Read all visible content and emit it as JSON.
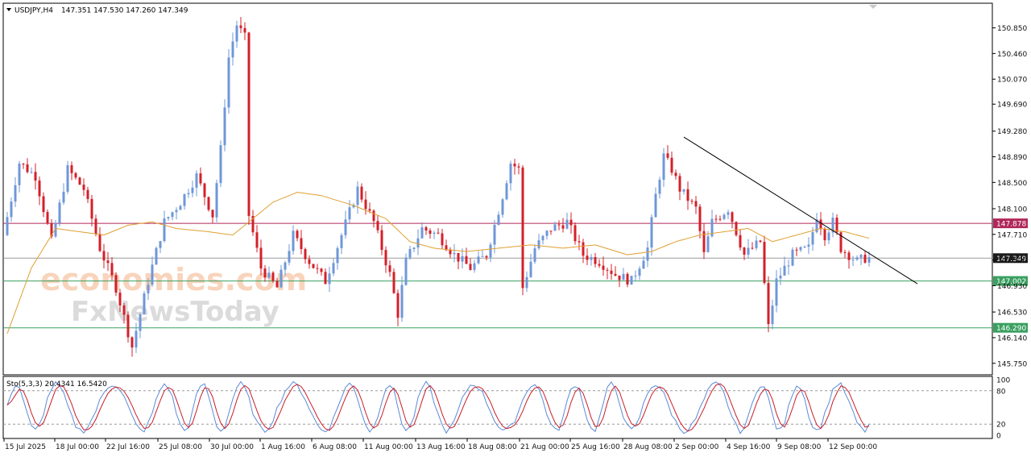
{
  "header": {
    "symbol": "USDJPY,H4",
    "ohlc": "147.351 147.530 147.260 147.349"
  },
  "watermark": {
    "line1": "economies.com",
    "line2": "FxNewsToday"
  },
  "colors": {
    "bull": "#6f97d8",
    "bear": "#d3202a",
    "ma": "#e0a030",
    "resistance": "#b0285a",
    "support": "#3aa060",
    "price": "#1c1c1c",
    "stoch_main": "#5b8ad6",
    "stoch_signal": "#c81e28"
  },
  "chart_data": [
    {
      "type": "candlestick",
      "title": "USDJPY,H4",
      "ylim": [
        145.6,
        151.2
      ],
      "y_ticks": [
        "150.850",
        "150.460",
        "150.070",
        "149.690",
        "149.280",
        "148.890",
        "148.500",
        "148.100",
        "147.710",
        "147.320",
        "146.930",
        "146.530",
        "146.140",
        "145.750"
      ],
      "x_ticks": [
        "15 Jul 2025",
        "18 Jul 00:00",
        "22 Jul 16:00",
        "25 Jul 08:00",
        "30 Jul 00:00",
        "1 Aug 16:00",
        "6 Aug 08:00",
        "11 Aug 00:00",
        "13 Aug 16:00",
        "18 Aug 08:00",
        "21 Aug 00:00",
        "25 Aug 16:00",
        "28 Aug 08:00",
        "2 Sep 00:00",
        "4 Sep 16:00",
        "9 Sep 08:00",
        "12 Sep 00:00"
      ],
      "close_path": [
        [
          0,
          147.7
        ],
        [
          4,
          148.8
        ],
        [
          8,
          148.6
        ],
        [
          12,
          147.6
        ],
        [
          16,
          148.7
        ],
        [
          20,
          148.4
        ],
        [
          24,
          147.5
        ],
        [
          28,
          146.9
        ],
        [
          32,
          146.0
        ],
        [
          36,
          147.0
        ],
        [
          40,
          147.9
        ],
        [
          44,
          148.2
        ],
        [
          48,
          148.6
        ],
        [
          52,
          148.0
        ],
        [
          54,
          149.0
        ],
        [
          56,
          150.4
        ],
        [
          58,
          150.9
        ],
        [
          60,
          150.7
        ],
        [
          61,
          148.0
        ],
        [
          64,
          147.2
        ],
        [
          68,
          146.9
        ],
        [
          72,
          147.7
        ],
        [
          76,
          147.3
        ],
        [
          80,
          147.0
        ],
        [
          84,
          147.7
        ],
        [
          88,
          148.4
        ],
        [
          92,
          147.9
        ],
        [
          96,
          147.1
        ],
        [
          98,
          146.5
        ],
        [
          100,
          147.3
        ],
        [
          104,
          147.8
        ],
        [
          108,
          147.7
        ],
        [
          112,
          147.4
        ],
        [
          116,
          147.2
        ],
        [
          120,
          147.4
        ],
        [
          124,
          148.3
        ],
        [
          126,
          148.8
        ],
        [
          128,
          148.7
        ],
        [
          129,
          146.9
        ],
        [
          132,
          147.5
        ],
        [
          136,
          147.8
        ],
        [
          140,
          147.9
        ],
        [
          144,
          147.4
        ],
        [
          148,
          147.3
        ],
        [
          152,
          147.1
        ],
        [
          156,
          147.0
        ],
        [
          160,
          147.5
        ],
        [
          162,
          148.3
        ],
        [
          164,
          148.9
        ],
        [
          166,
          148.7
        ],
        [
          168,
          148.4
        ],
        [
          172,
          148.1
        ],
        [
          174,
          147.4
        ],
        [
          176,
          147.9
        ],
        [
          180,
          148.1
        ],
        [
          184,
          147.4
        ],
        [
          188,
          147.6
        ],
        [
          190,
          146.3
        ],
        [
          192,
          147.0
        ],
        [
          196,
          147.4
        ],
        [
          200,
          147.5
        ],
        [
          202,
          148.0
        ],
        [
          204,
          147.7
        ],
        [
          206,
          147.9
        ],
        [
          208,
          147.5
        ],
        [
          212,
          147.3
        ],
        [
          214,
          147.35
        ]
      ],
      "ma_path": [
        [
          0,
          146.2
        ],
        [
          6,
          147.2
        ],
        [
          12,
          147.8
        ],
        [
          18,
          147.75
        ],
        [
          24,
          147.7
        ],
        [
          30,
          147.85
        ],
        [
          36,
          147.9
        ],
        [
          42,
          147.8
        ],
        [
          50,
          147.75
        ],
        [
          56,
          147.7
        ],
        [
          60,
          147.9
        ],
        [
          66,
          148.2
        ],
        [
          72,
          148.35
        ],
        [
          78,
          148.3
        ],
        [
          86,
          148.15
        ],
        [
          94,
          147.95
        ],
        [
          100,
          147.6
        ],
        [
          106,
          147.5
        ],
        [
          114,
          147.45
        ],
        [
          122,
          147.5
        ],
        [
          130,
          147.55
        ],
        [
          138,
          147.5
        ],
        [
          146,
          147.55
        ],
        [
          154,
          147.4
        ],
        [
          160,
          147.45
        ],
        [
          166,
          147.6
        ],
        [
          172,
          147.7
        ],
        [
          178,
          147.75
        ],
        [
          184,
          147.8
        ],
        [
          190,
          147.6
        ],
        [
          196,
          147.7
        ],
        [
          202,
          147.8
        ],
        [
          208,
          147.75
        ],
        [
          214,
          147.65
        ]
      ],
      "trendline": {
        "from": [
          168,
          149.19
        ],
        "to": [
          226,
          146.96
        ]
      },
      "levels": [
        {
          "name": "resistance",
          "value": "147.878"
        },
        {
          "name": "current",
          "value": "147.349"
        },
        {
          "name": "support-1",
          "value": "147.002"
        },
        {
          "name": "support-2",
          "value": "146.290"
        }
      ]
    },
    {
      "type": "line",
      "title": "Sto(5,3,3)",
      "label": "Sto(5,3,3) 20.4341 16.5420",
      "ylim": [
        0,
        100
      ],
      "y_ticks": [
        "100",
        "80",
        "20",
        "0"
      ],
      "levels": [
        80,
        20
      ],
      "main_last": 20.4341,
      "signal_last": 16.542
    }
  ]
}
